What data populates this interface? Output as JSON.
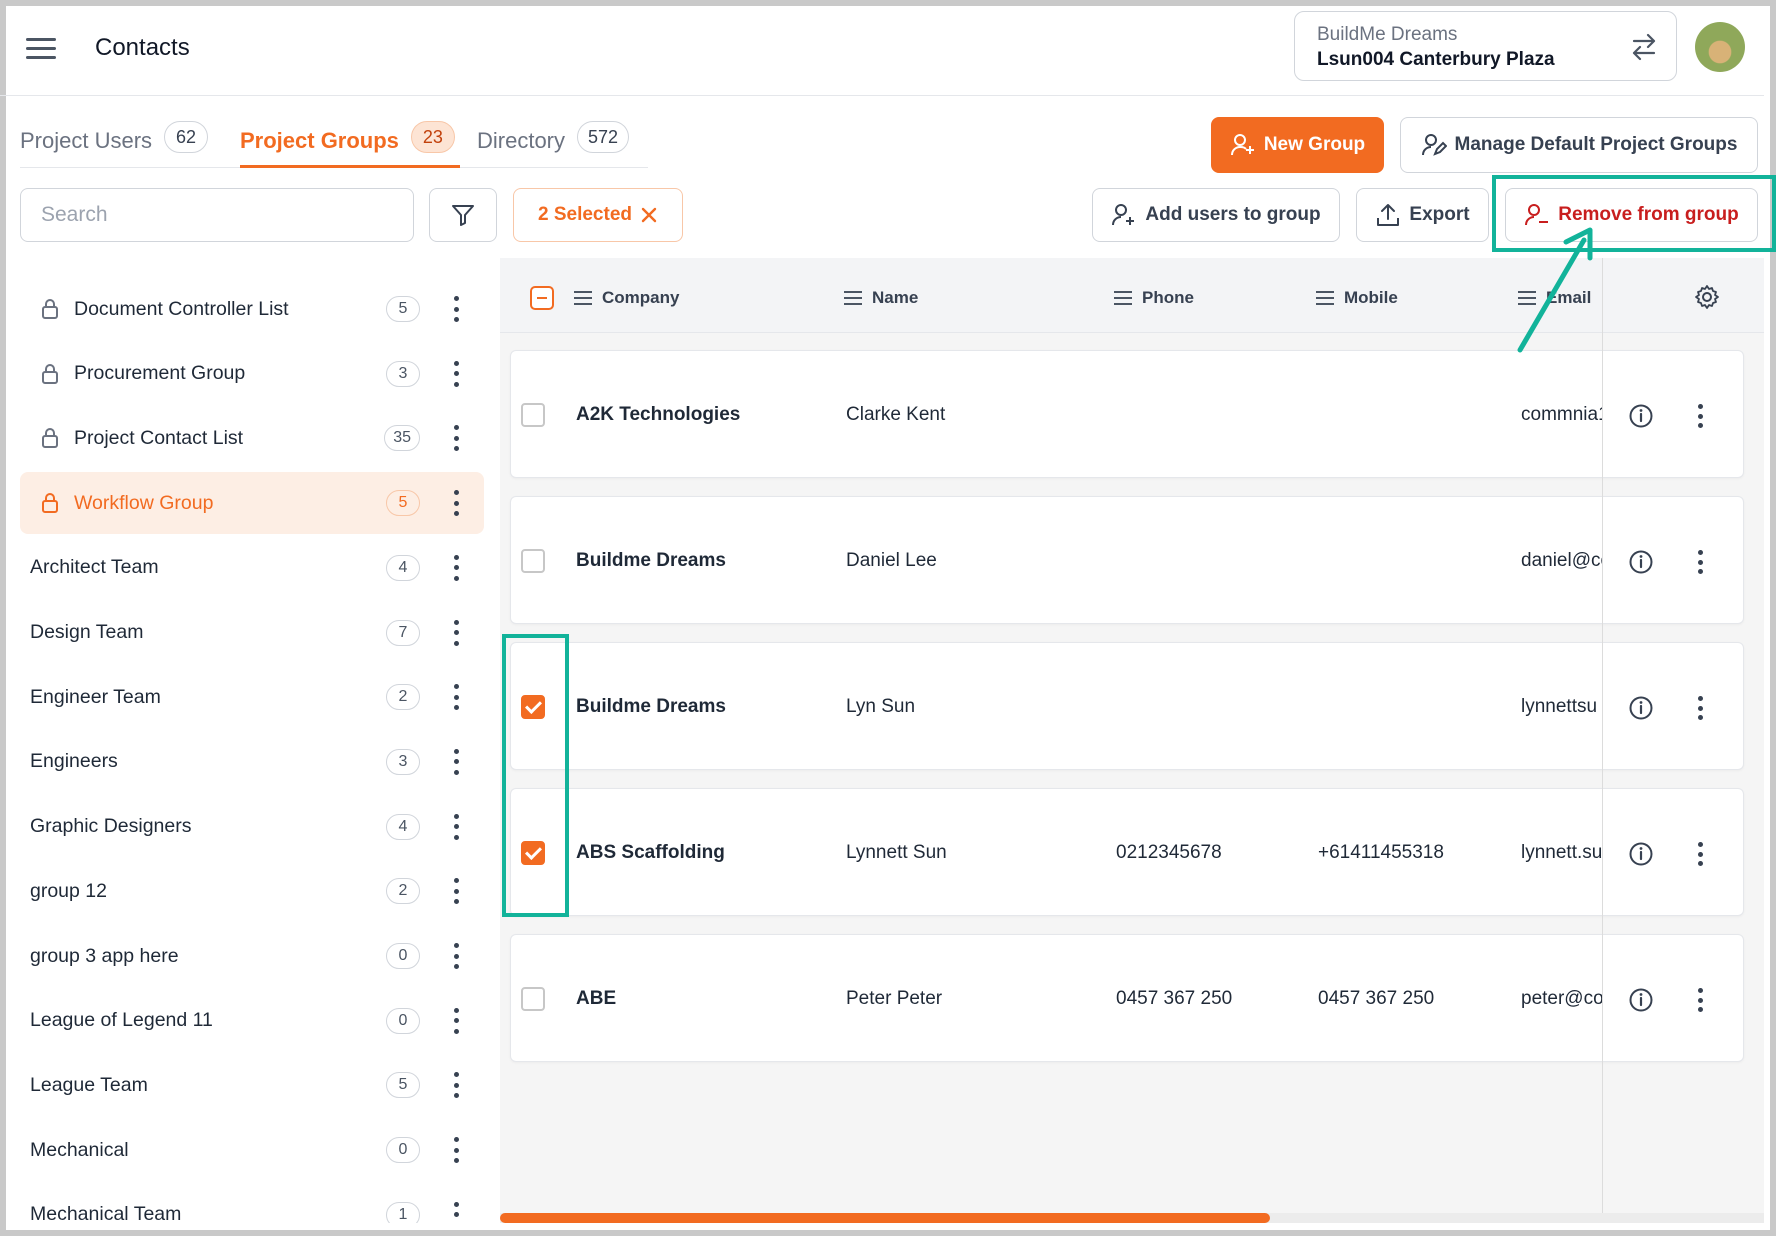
{
  "header": {
    "title": "Contacts",
    "project_company": "BuildMe Dreams",
    "project_name": "Lsun004 Canterbury Plaza"
  },
  "tabs": [
    {
      "label": "Project Users",
      "count": "62"
    },
    {
      "label": "Project Groups",
      "count": "23"
    },
    {
      "label": "Directory",
      "count": "572"
    }
  ],
  "actions": {
    "new_group": "New Group",
    "manage_default": "Manage Default Project Groups",
    "add_users": "Add users to group",
    "export": "Export",
    "remove_from_group": "Remove from group",
    "selected_chip": "2 Selected"
  },
  "search": {
    "placeholder": "Search"
  },
  "groups": [
    {
      "label": "Document Controller List",
      "count": "5",
      "locked": true
    },
    {
      "label": "Procurement Group",
      "count": "3",
      "locked": true
    },
    {
      "label": "Project Contact List",
      "count": "35",
      "locked": true
    },
    {
      "label": "Workflow Group",
      "count": "5",
      "locked": true,
      "active": true
    },
    {
      "label": "Architect Team",
      "count": "4"
    },
    {
      "label": "Design Team",
      "count": "7"
    },
    {
      "label": "Engineer Team",
      "count": "2"
    },
    {
      "label": "Engineers",
      "count": "3"
    },
    {
      "label": "Graphic Designers",
      "count": "4"
    },
    {
      "label": "group 12",
      "count": "2"
    },
    {
      "label": "group 3 app here",
      "count": "0"
    },
    {
      "label": "League of Legend 11",
      "count": "0"
    },
    {
      "label": "League Team",
      "count": "5"
    },
    {
      "label": "Mechanical",
      "count": "0"
    },
    {
      "label": "Mechanical Team",
      "count": "1"
    }
  ],
  "table": {
    "columns": [
      "Company",
      "Name",
      "Phone",
      "Mobile",
      "Email"
    ],
    "rows": [
      {
        "company": "A2K Technologies",
        "name": "Clarke Kent",
        "phone": "",
        "mobile": "",
        "email": "commnia1",
        "checked": false
      },
      {
        "company": "Buildme Dreams",
        "name": "Daniel Lee",
        "phone": "",
        "mobile": "",
        "email": "daniel@co",
        "checked": false
      },
      {
        "company": "Buildme Dreams",
        "name": "Lyn Sun",
        "phone": "",
        "mobile": "",
        "email": "lynnettsu",
        "checked": true
      },
      {
        "company": "ABS Scaffolding",
        "name": "Lynnett Sun",
        "phone": "0212345678",
        "mobile": "+61411455318",
        "email": "lynnett.su",
        "checked": true
      },
      {
        "company": "ABE",
        "name": "Peter Peter",
        "phone": "0457 367 250",
        "mobile": "0457 367 250",
        "email": "peter@co",
        "checked": false
      }
    ]
  },
  "colors": {
    "accent": "#f26b21",
    "annotation": "#12b39a",
    "danger": "#c81e1e"
  }
}
